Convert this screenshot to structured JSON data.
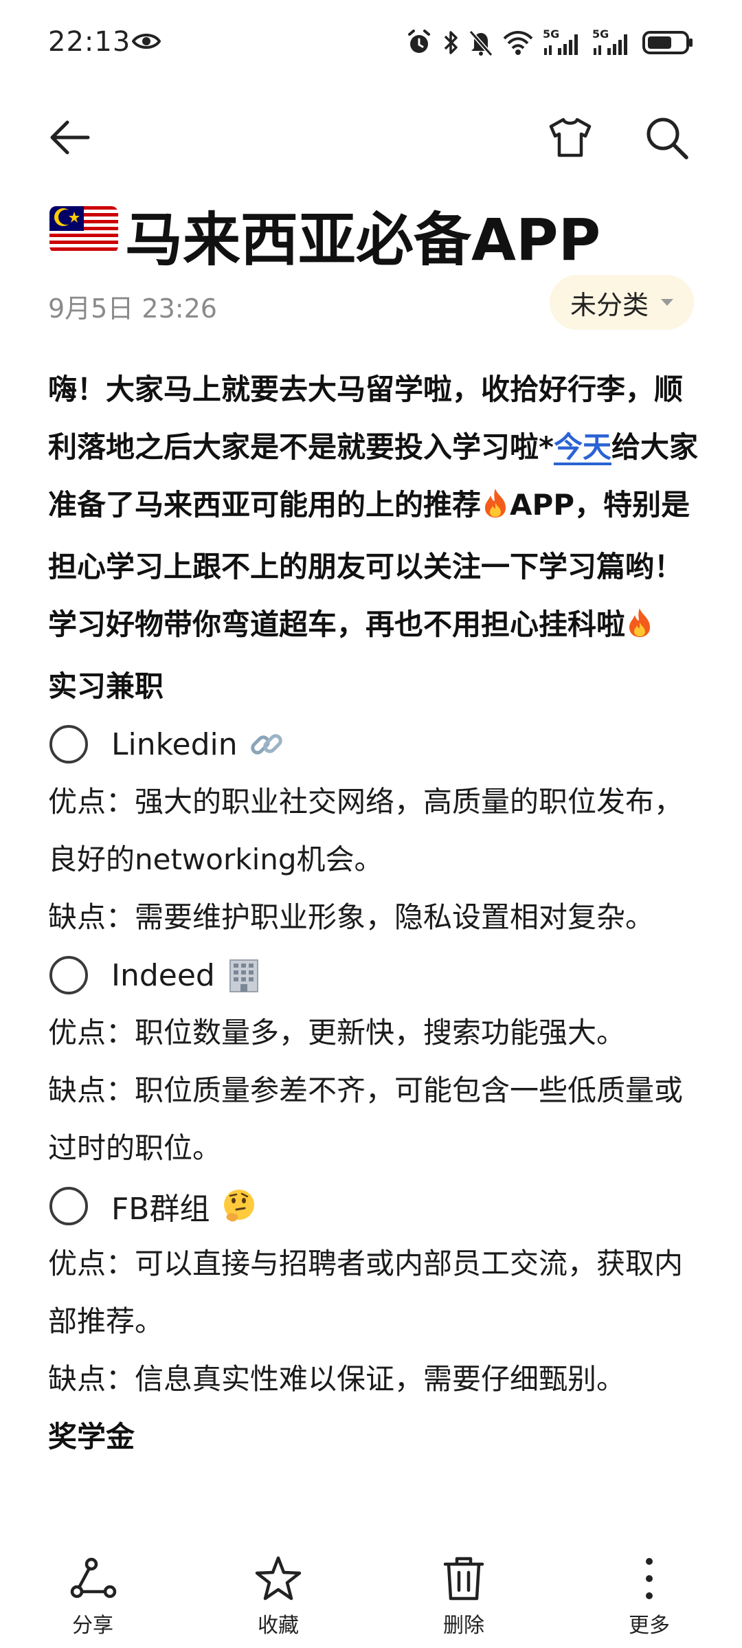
{
  "status_bar": {
    "time": "22:13",
    "network_1": "5G",
    "network_2": "5G"
  },
  "toolbar": {
    "back_icon": "back-arrow-icon",
    "theme_icon": "tshirt-icon",
    "search_icon": "search-icon"
  },
  "note": {
    "title": "马来西亚必备APP",
    "flag": "malaysia-flag-icon",
    "date": "9月5日 23:26",
    "category": "未分类"
  },
  "content": {
    "intro_part1": "嗨！大家马上就要去大马留学啦，收拾好行李，顺利落地之后大家是不是就要投入学习啦*",
    "intro_link": "今天",
    "intro_part2": "给大家准备了马来西亚可能用的上的推荐",
    "intro_part3": "APP，特别是担心学习上跟不上的朋友可以关注一下学习篇哟！学习好物带你弯道超车，再也不用担心挂科啦",
    "section_title": "实习兼职",
    "items": [
      {
        "label": "Linkedin",
        "emoji": "link-icon",
        "pros": "优点：强大的职业社交网络，高质量的职位发布，良好的networking机会。",
        "cons": "缺点：需要维护职业形象，隐私设置相对复杂。"
      },
      {
        "label": "Indeed",
        "emoji": "office-building-icon",
        "pros": "优点：职位数量多，更新快，搜索功能强大。",
        "cons": "缺点：职位质量参差不齐，可能包含一些低质量或过时的职位。"
      },
      {
        "label": "FB群组",
        "emoji": "thinking-face-icon",
        "pros": "优点：可以直接与招聘者或内部员工交流，获取内部推荐。",
        "cons": "缺点：信息真实性难以保证，需要仔细甄别。"
      }
    ],
    "cut_line": "奖学金"
  },
  "bottom_nav": {
    "share": "分享",
    "favorite": "收藏",
    "delete": "删除",
    "more": "更多"
  },
  "colors": {
    "link": "#2a63d4",
    "chip_bg": "#fdf6e3",
    "date_gray": "#8a8a8a"
  }
}
